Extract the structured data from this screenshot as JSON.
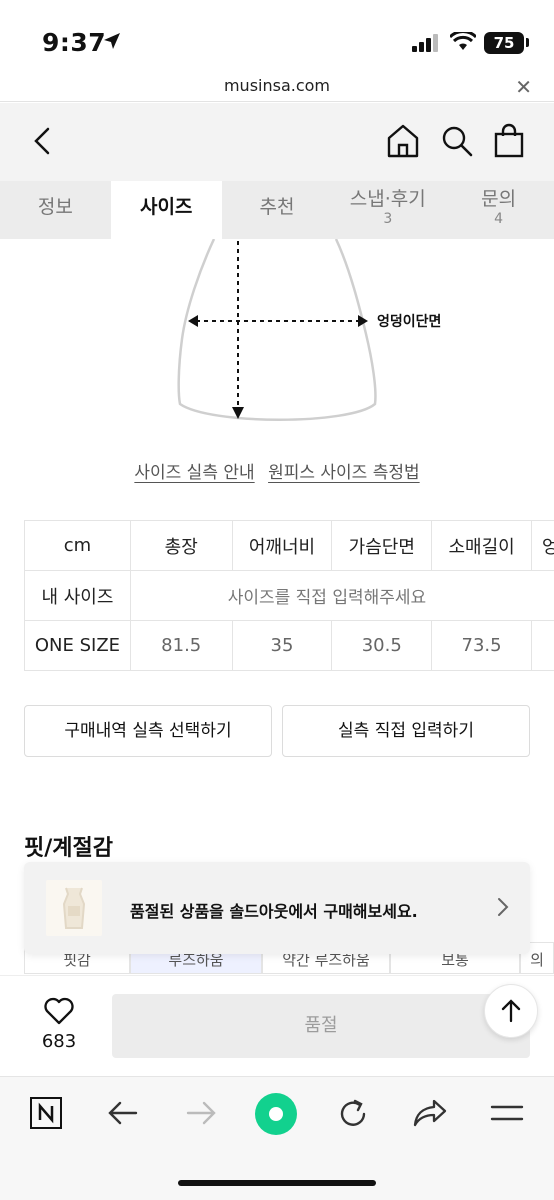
{
  "status": {
    "time": "9:37",
    "battery": "75"
  },
  "browser": {
    "url": "musinsa.com"
  },
  "tabs": [
    {
      "label": "정보",
      "count": ""
    },
    {
      "label": "사이즈",
      "count": ""
    },
    {
      "label": "추천",
      "count": ""
    },
    {
      "label": "스냅·후기",
      "count": "3"
    },
    {
      "label": "문의",
      "count": "4"
    }
  ],
  "active_tab": "사이즈",
  "diagram": {
    "label": "엉덩이단면"
  },
  "links": {
    "guide": "사이즈 실측 안내",
    "method": "원피스 사이즈 측정법"
  },
  "size_table": {
    "headers": [
      "cm",
      "총장",
      "어깨너비",
      "가슴단면",
      "소매길이",
      "엉"
    ],
    "my_size_label": "내 사이즈",
    "my_size_hint": "사이즈를 직접 입력해주세요",
    "row_label": "ONE SIZE",
    "row_values": [
      "81.5",
      "35",
      "30.5",
      "73.5"
    ]
  },
  "buttons": {
    "history": "구매내역 실측 선택하기",
    "direct": "실측 직접 입력하기"
  },
  "section": {
    "fit_title": "핏/계절감"
  },
  "fit_row": [
    "핏감",
    "루즈하움",
    "약간 루즈하움",
    "보통",
    "의"
  ],
  "toast": {
    "message": "품절된 상품을 솔드아웃에서 구매해보세요."
  },
  "buy": {
    "likes": "683",
    "button": "품절"
  },
  "colors": {
    "accent_green": "#12d18e",
    "tab_bg": "#ececec",
    "header_bg": "#f3f3f3"
  }
}
